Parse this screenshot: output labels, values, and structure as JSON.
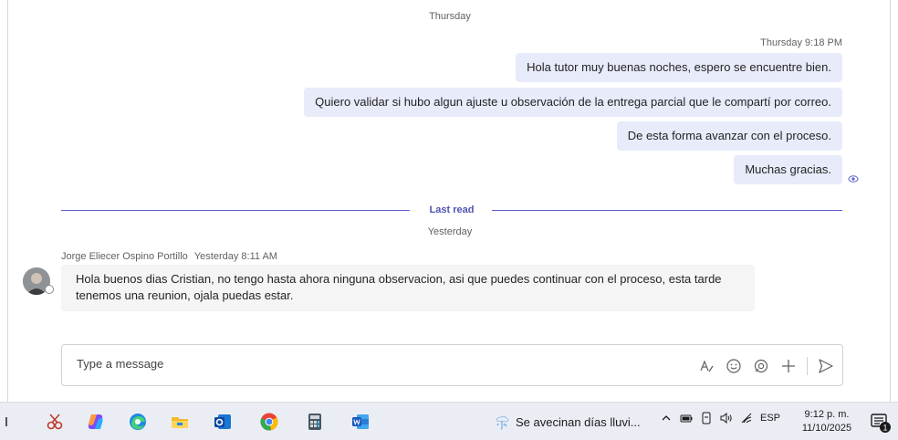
{
  "chat": {
    "day_top": "Thursday",
    "sent_timestamp": "Thursday 9:18 PM",
    "sent_messages": [
      "Hola tutor muy buenas noches, espero se encuentre bien.",
      "Quiero validar si hubo algun ajuste u observación de la entrega parcial que le compartí por correo.",
      "De esta forma avanzar con el proceso.",
      "Muchas gracias."
    ],
    "last_read_label": "Last read",
    "day_yesterday": "Yesterday",
    "received": {
      "sender": "Jorge Eliecer Ospino Portillo",
      "time": "Yesterday 8:11 AM",
      "text": "Hola buenos dias Cristian, no tengo hasta ahora ninguna observacion, asi que puedes continuar con el proceso, esta tarde tenemos una reunion, ojala puedas estar."
    }
  },
  "composer": {
    "placeholder": "Type a message",
    "tools": [
      "format-icon",
      "emoji-icon",
      "loop-icon",
      "plus-icon",
      "send-icon"
    ]
  },
  "taskbar": {
    "apps": [
      "snipping-tool-icon",
      "copilot-icon",
      "edge-icon",
      "file-explorer-icon",
      "outlook-icon",
      "chrome-icon",
      "calculator-icon",
      "word-icon"
    ],
    "weather_text": "Se avecinan días lluvi...",
    "tray_icons": [
      "chevron-up-icon",
      "battery-icon",
      "device-icon",
      "volume-icon",
      "wifi-icon"
    ],
    "language": "ESP",
    "clock_time": "9:12 p. m.",
    "clock_date": "11/10/2025",
    "notification_count": "1"
  },
  "colors": {
    "accent": "#5b5fc7",
    "sent_bubble": "#e8ebfa",
    "received_bubble": "#f5f5f5",
    "taskbar": "#eaeef4"
  }
}
